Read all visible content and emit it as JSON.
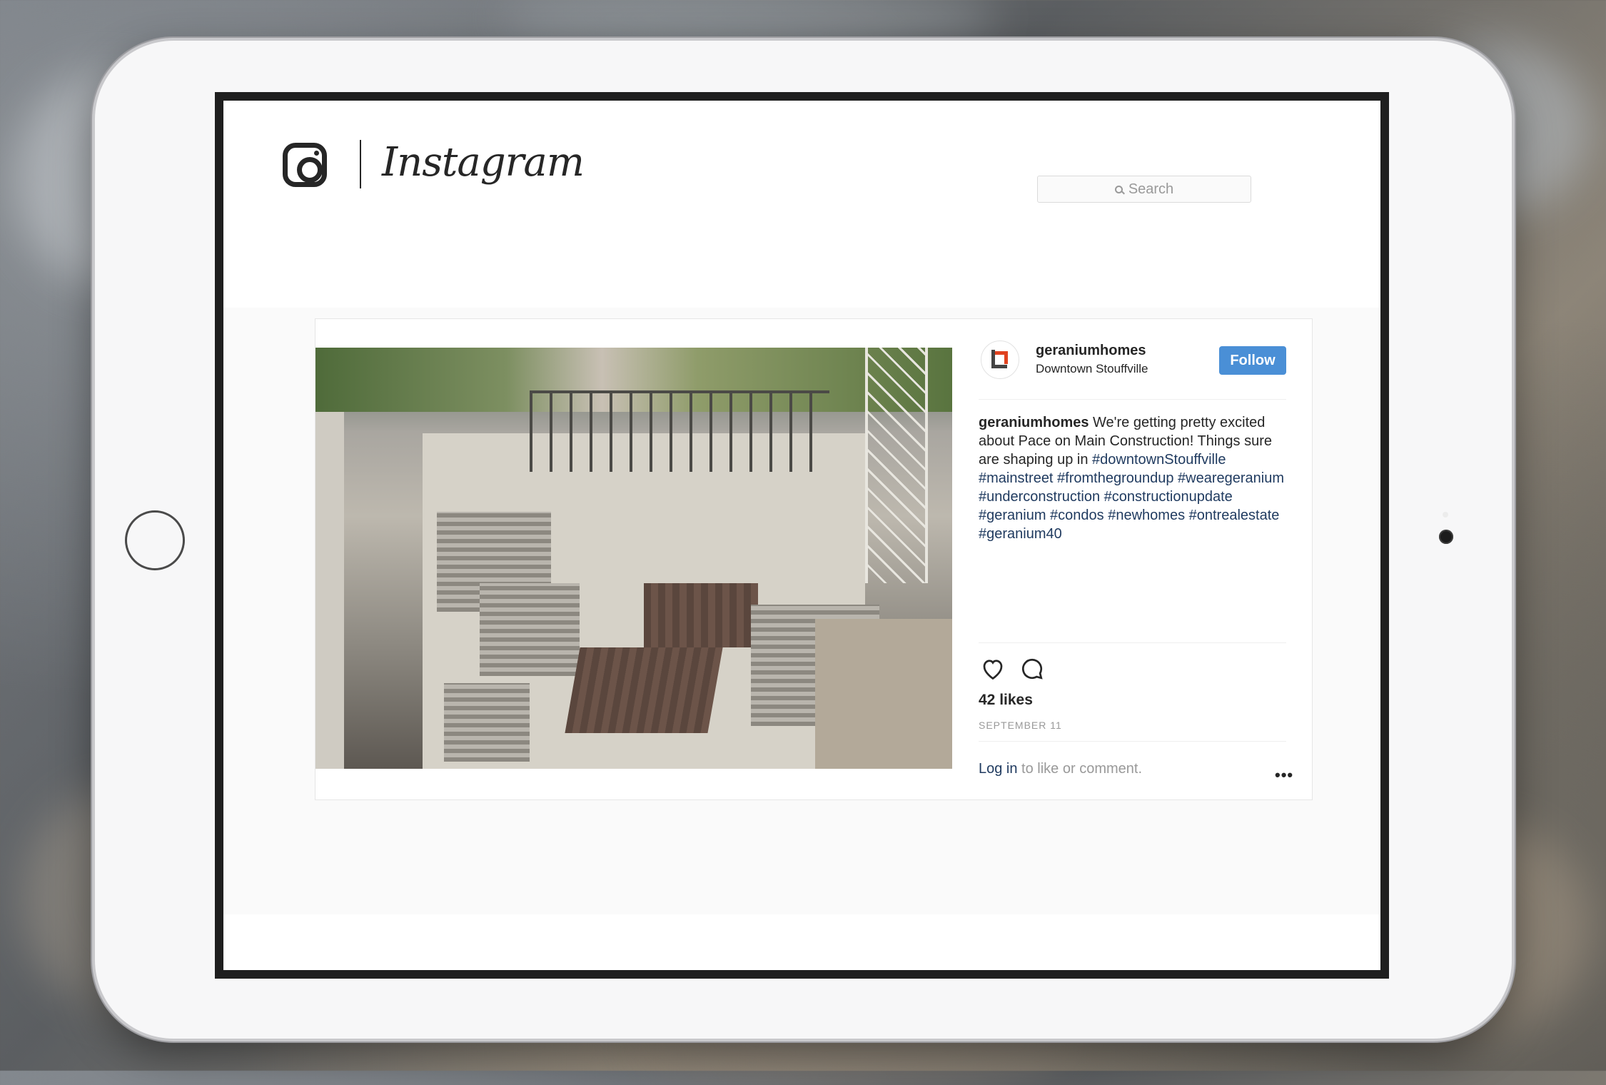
{
  "header": {
    "wordmark": "Instagram",
    "search_placeholder": "Search"
  },
  "post": {
    "username": "geraniumhomes",
    "location": "Downtown Stouffville",
    "follow_label": "Follow",
    "caption_user": "geraniumhomes",
    "caption_text": " We're getting pretty excited about Pace on Main Construction! Things sure are shaping up in ",
    "hashtags": "#downtownStouffville #mainstreet #fromthegroundup #wearegeranium #underconstruction #constructionupdate #geranium #condos #newhomes #ontrealestate #geranium40",
    "likes": "42 likes",
    "date": "SEPTEMBER 11",
    "login_link": "Log in",
    "login_text": " to like or comment.",
    "more_label": "•••"
  },
  "icons": [
    "instagram-glyph-icon",
    "search-icon",
    "heart-icon",
    "comment-icon",
    "more-options-icon"
  ],
  "colors": {
    "follow_button": "#4a8fd6",
    "hashtag": "#1f3a5f",
    "brand_red": "#e0421f"
  }
}
